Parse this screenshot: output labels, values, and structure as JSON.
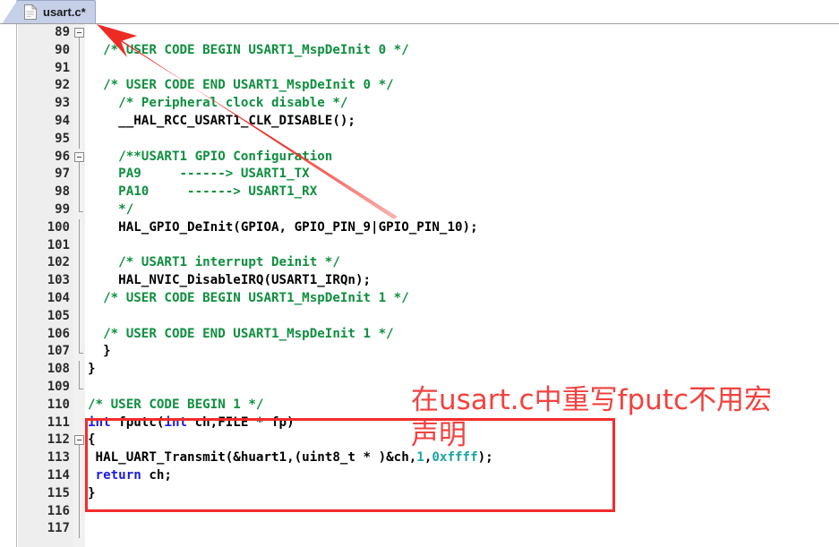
{
  "window": {
    "tab": {
      "label": "usart.c*",
      "icon": "document-icon",
      "active": true
    }
  },
  "editor": {
    "first_line": 89,
    "last_line": 117,
    "colors": {
      "comment": "#0f8f3f",
      "keyword": "#1a1ae0",
      "number": "#1aa3a3",
      "plain": "#000000",
      "gutter_bg": "#eeeeee",
      "annotation_red": "#f2423f",
      "tab_bg": "#c5cfe8"
    },
    "lines": [
      {
        "n": "89",
        "fold": "box",
        "tokens": []
      },
      {
        "n": "90",
        "fold": "bar",
        "tokens": [
          {
            "t": "cm",
            "s": "  /* USER CODE BEGIN USART1_MspDeInit 0 */"
          }
        ]
      },
      {
        "n": "91",
        "fold": "bar",
        "tokens": []
      },
      {
        "n": "92",
        "fold": "bar",
        "tokens": [
          {
            "t": "cm",
            "s": "  /* USER CODE END USART1_MspDeInit 0 */"
          }
        ]
      },
      {
        "n": "93",
        "fold": "bar",
        "tokens": [
          {
            "t": "cm",
            "s": "    /* Peripheral clock disable */"
          }
        ]
      },
      {
        "n": "94",
        "fold": "bar",
        "tokens": [
          {
            "t": "pl",
            "s": "    __HAL_RCC_USART1_CLK_DISABLE();"
          }
        ]
      },
      {
        "n": "95",
        "fold": "bar",
        "tokens": []
      },
      {
        "n": "96",
        "fold": "box",
        "tokens": [
          {
            "t": "cm",
            "s": "    /**USART1 GPIO Configuration"
          }
        ]
      },
      {
        "n": "97",
        "fold": "bar",
        "tokens": [
          {
            "t": "cm",
            "s": "    PA9     ------> USART1_TX"
          }
        ]
      },
      {
        "n": "98",
        "fold": "bar",
        "tokens": [
          {
            "t": "cm",
            "s": "    PA10     ------> USART1_RX"
          }
        ]
      },
      {
        "n": "99",
        "fold": "end",
        "tokens": [
          {
            "t": "cm",
            "s": "    */"
          }
        ]
      },
      {
        "n": "100",
        "fold": "bar",
        "tokens": [
          {
            "t": "pl",
            "s": "    HAL_GPIO_DeInit(GPIOA, GPIO_PIN_9|GPIO_PIN_10);"
          }
        ]
      },
      {
        "n": "101",
        "fold": "bar",
        "tokens": []
      },
      {
        "n": "102",
        "fold": "bar",
        "tokens": [
          {
            "t": "cm",
            "s": "    /* USART1 interrupt Deinit */"
          }
        ]
      },
      {
        "n": "103",
        "fold": "bar",
        "tokens": [
          {
            "t": "pl",
            "s": "    HAL_NVIC_DisableIRQ(USART1_IRQn);"
          }
        ]
      },
      {
        "n": "104",
        "fold": "bar",
        "tokens": [
          {
            "t": "cm",
            "s": "  /* USER CODE BEGIN USART1_MspDeInit 1 */"
          }
        ]
      },
      {
        "n": "105",
        "fold": "bar",
        "tokens": []
      },
      {
        "n": "106",
        "fold": "bar",
        "tokens": [
          {
            "t": "cm",
            "s": "  /* USER CODE END USART1_MspDeInit 1 */"
          }
        ]
      },
      {
        "n": "107",
        "fold": "end",
        "tokens": [
          {
            "t": "pl",
            "s": "  }"
          }
        ]
      },
      {
        "n": "108",
        "fold": "bar",
        "tokens": [
          {
            "t": "pl",
            "s": "}"
          }
        ]
      },
      {
        "n": "109",
        "fold": "end",
        "tokens": []
      },
      {
        "n": "110",
        "fold": "none",
        "tokens": [
          {
            "t": "cm",
            "s": "/* USER CODE BEGIN 1 */"
          }
        ]
      },
      {
        "n": "111",
        "fold": "none",
        "tokens": [
          {
            "t": "kw",
            "s": "int"
          },
          {
            "t": "pl",
            "s": " fputc("
          },
          {
            "t": "kw",
            "s": "int"
          },
          {
            "t": "pl",
            "s": " ch,FILE * fp)"
          }
        ]
      },
      {
        "n": "112",
        "fold": "box",
        "tokens": [
          {
            "t": "pl",
            "s": "{"
          }
        ]
      },
      {
        "n": "113",
        "fold": "bar",
        "tokens": [
          {
            "t": "pl",
            "s": " HAL_UART_Transmit(&huart1,(uint8_t * )&ch,"
          },
          {
            "t": "num",
            "s": "1"
          },
          {
            "t": "pl",
            "s": ","
          },
          {
            "t": "num",
            "s": "0xffff"
          },
          {
            "t": "pl",
            "s": ");"
          }
        ]
      },
      {
        "n": "114",
        "fold": "bar",
        "tokens": [
          {
            "t": "pl",
            "s": " "
          },
          {
            "t": "kw",
            "s": "return"
          },
          {
            "t": "pl",
            "s": " ch;"
          }
        ]
      },
      {
        "n": "115",
        "fold": "bar",
        "tokens": [
          {
            "t": "pl",
            "s": "}"
          }
        ]
      },
      {
        "n": "116",
        "fold": "bar",
        "tokens": []
      },
      {
        "n": "117",
        "fold": "bar",
        "tokens": []
      }
    ]
  },
  "annotations": {
    "chinese_note": "在usart.c中重写fputc不用宏\n声明",
    "highlight_box_label": "fputc-code-highlight-box",
    "arrow_label": "red-arrow-to-tab"
  }
}
